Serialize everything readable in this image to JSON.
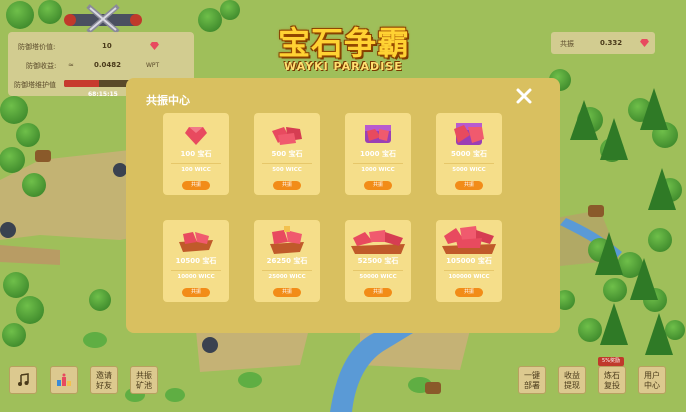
{
  "top_left": {
    "defense_tower_value_label": "防御塔价值:",
    "defense_tower_value": "10",
    "defense_income_label": "防御收益:",
    "defense_income_prefix": "≈",
    "defense_income_value": "0.0482",
    "defense_income_unit": "WPT",
    "protector_label": "防御塔维护值",
    "protector_level": 0.28,
    "timer": "68:15:15"
  },
  "logo": {
    "title": "宝石争霸",
    "subtitle": "WAYKI PARADISE"
  },
  "top_right": {
    "label": "共振",
    "value": "0.332"
  },
  "modal": {
    "title": "共振中心",
    "cards": [
      {
        "gems": "100 宝石",
        "price": "100 WICC",
        "button": "共振"
      },
      {
        "gems": "500 宝石",
        "price": "500 WICC",
        "button": "共振"
      },
      {
        "gems": "1000 宝石",
        "price": "1000 WICC",
        "button": "共振"
      },
      {
        "gems": "5000 宝石",
        "price": "5000 WICC",
        "button": "共振"
      },
      {
        "gems": "10500 宝石",
        "price": "10000 WICC",
        "button": "共振"
      },
      {
        "gems": "26250 宝石",
        "price": "25000 WICC",
        "button": "共振"
      },
      {
        "gems": "52500 宝石",
        "price": "50000 WICC",
        "button": "共振"
      },
      {
        "gems": "105000 宝石",
        "price": "100000 WICC",
        "button": "共振"
      }
    ]
  },
  "bottom_left": {
    "music_icon": "music-note-icon",
    "rank_icon": "podium-icon",
    "invite": [
      "邀请",
      "好友"
    ],
    "pool": [
      "共振",
      "矿池"
    ]
  },
  "bottom_right": {
    "deploy": [
      "一键",
      "部署"
    ],
    "withdraw": [
      "收益",
      "提现"
    ],
    "reinvest_badge": "5%奖励",
    "reinvest": [
      "炼石",
      "复投"
    ],
    "user_center": [
      "用户",
      "中心"
    ]
  },
  "colors": {
    "gem": "#e84a5f",
    "button": "#f28c18",
    "modal": "#d9c060",
    "card": "#f5de8a"
  }
}
